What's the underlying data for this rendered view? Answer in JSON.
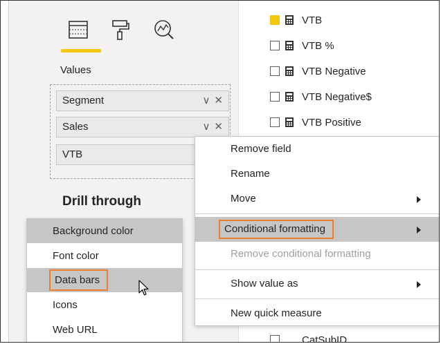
{
  "viz_pane": {
    "tabs": [
      {
        "name": "fields-tab",
        "icon": "table-fields-icon",
        "active": true
      },
      {
        "name": "format-tab",
        "icon": "paint-roller-icon",
        "active": false
      },
      {
        "name": "analytics-tab",
        "icon": "analytics-magnifier-icon",
        "active": false
      }
    ],
    "values_label": "Values",
    "fields": [
      {
        "label": "Segment"
      },
      {
        "label": "Sales"
      },
      {
        "label": "VTB"
      }
    ],
    "drill_title": "Drill through"
  },
  "field_list": {
    "items": [
      {
        "label": "VTB",
        "checked": true
      },
      {
        "label": "VTB %",
        "checked": false
      },
      {
        "label": "VTB Negative",
        "checked": false
      },
      {
        "label": "VTB Negative$",
        "checked": false
      },
      {
        "label": "VTB Positive",
        "checked": false
      },
      {
        "label": "CatSubID",
        "checked": false
      }
    ]
  },
  "context_menu": {
    "items": [
      {
        "label": "Remove field",
        "disabled": false,
        "submenu": false
      },
      {
        "label": "Rename",
        "disabled": false,
        "submenu": false
      },
      {
        "label": "Move",
        "disabled": false,
        "submenu": true
      },
      {
        "label": "Conditional formatting",
        "disabled": false,
        "submenu": true,
        "highlighted": true
      },
      {
        "label": "Remove conditional formatting",
        "disabled": true,
        "submenu": false
      },
      {
        "label": "Show value as",
        "disabled": false,
        "submenu": true
      },
      {
        "label": "New quick measure",
        "disabled": false,
        "submenu": false
      }
    ]
  },
  "submenu": {
    "items": [
      {
        "label": "Background color"
      },
      {
        "label": "Font color"
      },
      {
        "label": "Data bars"
      },
      {
        "label": "Icons"
      },
      {
        "label": "Web URL"
      }
    ]
  },
  "colors": {
    "accent_yellow": "#f2c80f",
    "highlight_outline": "#ed7d31",
    "menu_hover": "#c8c6c4",
    "disabled_text": "#a19f9d"
  }
}
